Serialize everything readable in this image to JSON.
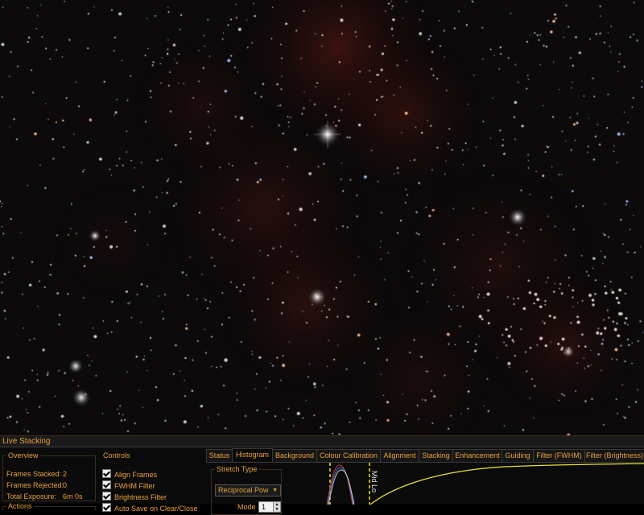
{
  "window": {
    "title": "Live Stacking"
  },
  "overview": {
    "legend": "Overview",
    "frames_stacked_label": "Frames Stacked:",
    "frames_stacked_value": "2",
    "frames_rejected_label": "Frames Rejected:",
    "frames_rejected_value": "0",
    "total_exposure_label": "Total Exposure:",
    "total_exposure_value": "6m 0s"
  },
  "actions": {
    "legend": "Actions"
  },
  "controls": {
    "legend": "Controls",
    "items": [
      {
        "label": "Align Frames",
        "checked": true
      },
      {
        "label": "FWHM Filter",
        "checked": true
      },
      {
        "label": "Brightness Filter",
        "checked": true
      },
      {
        "label": "Auto Save on Clear/Close",
        "checked": true
      }
    ]
  },
  "tabs": [
    {
      "label": "Status",
      "active": false
    },
    {
      "label": "Histogram",
      "active": true
    },
    {
      "label": "Background",
      "active": false
    },
    {
      "label": "Colour Calibration",
      "active": false
    },
    {
      "label": "Alignment",
      "active": false
    },
    {
      "label": "Stacking",
      "active": false
    },
    {
      "label": "Enhancement",
      "active": false
    },
    {
      "label": "Guiding",
      "active": false
    },
    {
      "label": "Filter (FWHM)",
      "active": false
    },
    {
      "label": "Filter (Brightness)",
      "active": false
    }
  ],
  "histogram": {
    "stretch_legend": "Stretch Type",
    "stretch_type": "Reciprocal Pow",
    "mode_label": "Mode",
    "mode_value": "1",
    "marker_label": "Mid Lo",
    "marker_color": "#f2e21a",
    "curve_color": "#e8e03a"
  },
  "colors": {
    "accent": "#e9a23b",
    "nebula": "#7a1e14"
  }
}
